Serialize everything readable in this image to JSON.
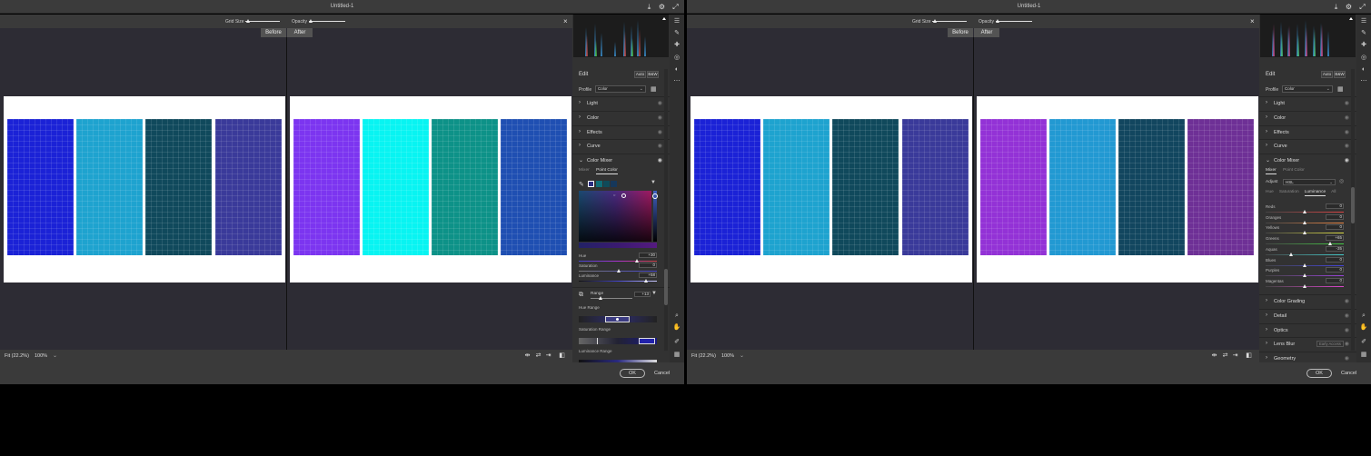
{
  "app": {
    "title": "Untitled-1"
  },
  "toolbar": {
    "grid_size_label": "Grid Size",
    "opacity_label": "Opacity"
  },
  "view": {
    "before_label": "Before",
    "after_label": "After"
  },
  "bottom": {
    "fit_label": "Fit (22.2%)",
    "zoom_label": "100%"
  },
  "dialog": {
    "ok_label": "OK",
    "cancel_label": "Cancel"
  },
  "panel": {
    "edit_label": "Edit",
    "auto_label": "Auto",
    "bw_label": "B&W",
    "profile_label": "Profile",
    "profile_value": "Color"
  },
  "left": {
    "swatches_before": [
      "#1b22d6",
      "#1ea3cf",
      "#10495c",
      "#3a3a9a"
    ],
    "swatches_after": [
      "#7c35f0",
      "#08f4f2",
      "#0d9288",
      "#1f4fb2"
    ],
    "sections": [
      {
        "name": "section-light",
        "label": "Light"
      },
      {
        "name": "section-color",
        "label": "Color"
      },
      {
        "name": "section-effects",
        "label": "Effects"
      },
      {
        "name": "section-curve",
        "label": "Curve"
      }
    ],
    "color_mixer": {
      "label": "Color Mixer",
      "tab_mixer": "Mixer",
      "tab_point_color": "Point Color",
      "hue_label": "Hue",
      "hue_value": "+30",
      "saturation_label": "Saturation",
      "saturation_value": "0",
      "luminance_label": "Luminance",
      "luminance_value": "+58",
      "range_label": "Range",
      "range_value": "+13",
      "hue_range_label": "Hue Range",
      "saturation_range_label": "Saturation Range",
      "luminance_range_label": "Luminance Range"
    }
  },
  "right": {
    "swatches_before": [
      "#1b22d6",
      "#1ea3cf",
      "#10495c",
      "#3a3a9a"
    ],
    "swatches_after": [
      "#9332d6",
      "#2299d2",
      "#12465f",
      "#6e3096"
    ],
    "sections_top": [
      {
        "name": "section-light",
        "label": "Light"
      },
      {
        "name": "section-color",
        "label": "Color"
      },
      {
        "name": "section-effects",
        "label": "Effects"
      },
      {
        "name": "section-curve",
        "label": "Curve"
      }
    ],
    "color_mixer": {
      "label": "Color Mixer",
      "tab_mixer": "Mixer",
      "tab_point_color": "Point Color",
      "adjust_label": "Adjust",
      "adjust_value": "HSL",
      "subtabs": [
        "Hue",
        "Saturation",
        "Luminance",
        "All"
      ],
      "active_subtab": "Luminance",
      "sliders": [
        {
          "label": "Reds",
          "value": "0",
          "pos": 0.5,
          "color": "#d44"
        },
        {
          "label": "Oranges",
          "value": "0",
          "pos": 0.5,
          "color": "#e84"
        },
        {
          "label": "Yellows",
          "value": "0",
          "pos": 0.5,
          "color": "#dd4"
        },
        {
          "label": "Greens",
          "value": "+65",
          "pos": 0.82,
          "color": "#4c4"
        },
        {
          "label": "Aquas",
          "value": "-35",
          "pos": 0.33,
          "color": "#4cc"
        },
        {
          "label": "Blues",
          "value": "0",
          "pos": 0.5,
          "color": "#44d"
        },
        {
          "label": "Purples",
          "value": "0",
          "pos": 0.5,
          "color": "#94d"
        },
        {
          "label": "Magentas",
          "value": "0",
          "pos": 0.5,
          "color": "#d4c"
        }
      ]
    },
    "sections_bottom": [
      {
        "name": "section-color-grading",
        "label": "Color Grading"
      },
      {
        "name": "section-detail",
        "label": "Detail"
      },
      {
        "name": "section-optics",
        "label": "Optics"
      },
      {
        "name": "section-lens-blur",
        "label": "Lens Blur",
        "badge": "Early Access"
      },
      {
        "name": "section-geometry",
        "label": "Geometry"
      }
    ]
  }
}
